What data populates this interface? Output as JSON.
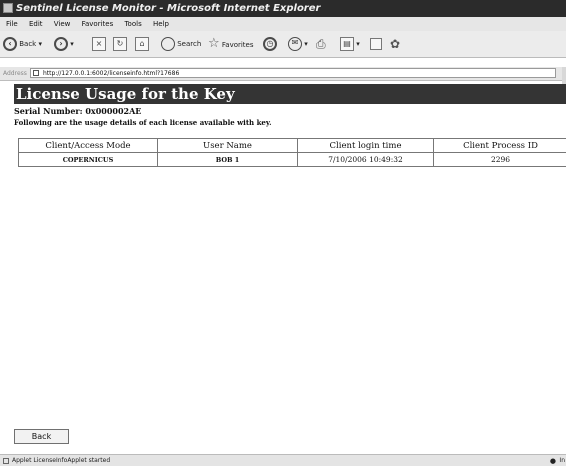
{
  "window": {
    "title": "Sentinel License Monitor - Microsoft Internet Explorer"
  },
  "menu": [
    "File",
    "Edit",
    "View",
    "Favorites",
    "Tools",
    "Help"
  ],
  "toolbar": {
    "back": "Back",
    "search": "Search",
    "favorites": "Favorites"
  },
  "address": {
    "label": "Address",
    "url": "http://127.0.0.1:6002/licenseinfo.html?17686"
  },
  "page": {
    "heading": "License Usage for the Key",
    "serial": "Serial Number: 0x000002AE",
    "description": "Following are the usage details of each license available with key."
  },
  "table": {
    "headers": [
      "Client/Access Mode",
      "User Name",
      "Client login time",
      "Client Process ID"
    ],
    "rows": [
      [
        "COPERNICUS",
        "BOB 1",
        "7/10/2006 10:49:32",
        "2296"
      ]
    ]
  },
  "back_button": "Back",
  "status": {
    "text": "Applet LicenseInfoApplet started",
    "zone": "In"
  }
}
